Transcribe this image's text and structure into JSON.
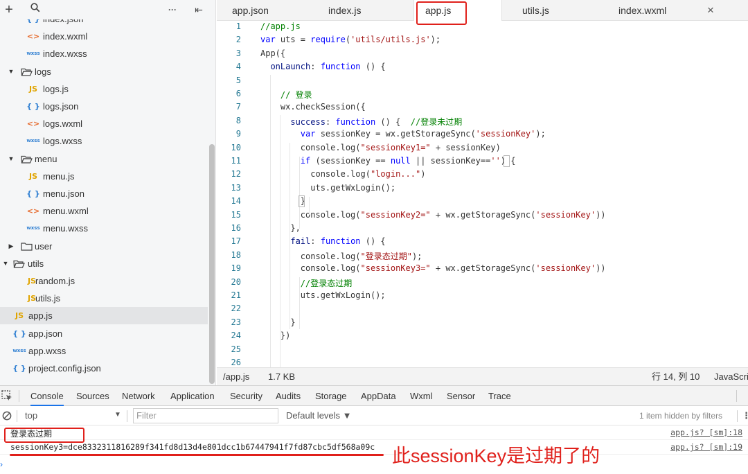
{
  "sidebar": {
    "toolbar": {
      "add": "+",
      "search": "⌕",
      "more": "···",
      "collapse": "⇤"
    },
    "rows": [
      {
        "name": "index.json",
        "icon": "json",
        "depth": 2,
        "kind": "file"
      },
      {
        "name": "index.wxml",
        "icon": "wxml",
        "depth": 2,
        "kind": "file"
      },
      {
        "name": "index.wxss",
        "icon": "wxss",
        "depth": 2,
        "kind": "file"
      },
      {
        "name": "logs",
        "icon": "folder-open",
        "depth": 1,
        "kind": "folder",
        "expanded": true
      },
      {
        "name": "logs.js",
        "icon": "js",
        "depth": 2,
        "kind": "file"
      },
      {
        "name": "logs.json",
        "icon": "json",
        "depth": 2,
        "kind": "file"
      },
      {
        "name": "logs.wxml",
        "icon": "wxml",
        "depth": 2,
        "kind": "file"
      },
      {
        "name": "logs.wxss",
        "icon": "wxss",
        "depth": 2,
        "kind": "file"
      },
      {
        "name": "menu",
        "icon": "folder-open",
        "depth": 1,
        "kind": "folder",
        "expanded": true
      },
      {
        "name": "menu.js",
        "icon": "js",
        "depth": 2,
        "kind": "file"
      },
      {
        "name": "menu.json",
        "icon": "json",
        "depth": 2,
        "kind": "file"
      },
      {
        "name": "menu.wxml",
        "icon": "wxml",
        "depth": 2,
        "kind": "file"
      },
      {
        "name": "menu.wxss",
        "icon": "wxss",
        "depth": 2,
        "kind": "file"
      },
      {
        "name": "user",
        "icon": "folder-closed",
        "depth": 1,
        "kind": "folder",
        "expanded": false
      },
      {
        "name": "utils",
        "icon": "folder-open",
        "depth": 0,
        "kind": "folder",
        "expanded": true
      },
      {
        "name": "random.js",
        "icon": "js",
        "depth": 1,
        "kind": "file"
      },
      {
        "name": "utils.js",
        "icon": "js",
        "depth": 1,
        "kind": "file"
      },
      {
        "name": "app.js",
        "icon": "js",
        "depth": 0,
        "kind": "file",
        "active": true
      },
      {
        "name": "app.json",
        "icon": "json",
        "depth": 0,
        "kind": "file"
      },
      {
        "name": "app.wxss",
        "icon": "wxss",
        "depth": 0,
        "kind": "file"
      },
      {
        "name": "project.config.json",
        "icon": "json",
        "depth": 0,
        "kind": "file"
      }
    ]
  },
  "icons": {
    "js": "JS",
    "json": "{ }",
    "wxml": "<>",
    "wxss": "wxss"
  },
  "tabs": [
    {
      "label": "app.json",
      "active": false
    },
    {
      "label": "index.js",
      "active": false
    },
    {
      "label": "app.js",
      "active": true
    },
    {
      "label": "utils.js",
      "active": false
    },
    {
      "label": "index.wxml",
      "active": false
    }
  ],
  "tab_close": "×",
  "editor": {
    "lines": [
      [
        [
          "c-cm",
          "//app.js"
        ]
      ],
      [
        [
          "c-kw",
          "var"
        ],
        [
          "",
          " uts = "
        ],
        [
          "c-kw",
          "require"
        ],
        [
          "",
          "("
        ],
        [
          "c-str",
          "'utils/utils.js'"
        ],
        [
          "",
          ");"
        ]
      ],
      [
        [
          "",
          "App({"
        ]
      ],
      [
        [
          "",
          "  "
        ],
        [
          "c-prop",
          "onLaunch"
        ],
        [
          "",
          ": "
        ],
        [
          "c-kw",
          "function"
        ],
        [
          "",
          " () {"
        ]
      ],
      [
        [
          "",
          ""
        ]
      ],
      [
        [
          "",
          "    "
        ],
        [
          "c-cm",
          "// 登录"
        ]
      ],
      [
        [
          "",
          "    wx.checkSession({"
        ]
      ],
      [
        [
          "",
          "      "
        ],
        [
          "c-prop",
          "success"
        ],
        [
          "",
          ": "
        ],
        [
          "c-kw",
          "function"
        ],
        [
          "",
          " () {  "
        ],
        [
          "c-cm",
          "//登录未过期"
        ]
      ],
      [
        [
          "",
          "        "
        ],
        [
          "c-kw",
          "var"
        ],
        [
          "",
          " sessionKey = wx.getStorageSync("
        ],
        [
          "c-str",
          "'sessionKey'"
        ],
        [
          "",
          ");"
        ]
      ],
      [
        [
          "",
          "        console.log("
        ],
        [
          "c-str",
          "\"sessionKey1=\""
        ],
        [
          "",
          " + sessionKey)"
        ]
      ],
      [
        [
          "",
          "        "
        ],
        [
          "c-kw",
          "if"
        ],
        [
          "",
          " (sessionKey == "
        ],
        [
          "c-kw",
          "null"
        ],
        [
          "",
          " || sessionKey=="
        ],
        [
          "c-str",
          "''"
        ],
        [
          "",
          ") {"
        ]
      ],
      [
        [
          "",
          "          console.log("
        ],
        [
          "c-str",
          "\"login...\""
        ],
        [
          "",
          ")"
        ]
      ],
      [
        [
          "",
          "          uts.getWxLogin();"
        ]
      ],
      [
        [
          "",
          "        }"
        ]
      ],
      [
        [
          "",
          "        console.log("
        ],
        [
          "c-str",
          "\"sessionKey2=\""
        ],
        [
          "",
          " + wx.getStorageSync("
        ],
        [
          "c-str",
          "'sessionKey'"
        ],
        [
          "",
          "))"
        ]
      ],
      [
        [
          "",
          "      },"
        ]
      ],
      [
        [
          "",
          "      "
        ],
        [
          "c-prop",
          "fail"
        ],
        [
          "",
          ": "
        ],
        [
          "c-kw",
          "function"
        ],
        [
          "",
          " () {"
        ]
      ],
      [
        [
          "",
          "        console.log("
        ],
        [
          "c-str",
          "\"登录态过期\""
        ],
        [
          "",
          ");"
        ]
      ],
      [
        [
          "",
          "        console.log("
        ],
        [
          "c-str",
          "\"sessionKey3=\""
        ],
        [
          "",
          " + wx.getStorageSync("
        ],
        [
          "c-str",
          "'sessionKey'"
        ],
        [
          "",
          "))"
        ]
      ],
      [
        [
          "",
          "        "
        ],
        [
          "c-cm",
          "//登录态过期"
        ]
      ],
      [
        [
          "",
          "        uts.getWxLogin();"
        ]
      ],
      [
        [
          "",
          ""
        ]
      ],
      [
        [
          "",
          "      }"
        ]
      ],
      [
        [
          "",
          "    })"
        ]
      ],
      [
        [
          "",
          ""
        ]
      ],
      [
        [
          "",
          ""
        ]
      ]
    ]
  },
  "statusbar": {
    "path": "/app.js",
    "size": "1.7 KB",
    "cursor": "行 14, 列 10",
    "language": "JavaScri"
  },
  "devtools": {
    "tabs": [
      "Console",
      "Sources",
      "Network",
      "Application",
      "Security",
      "Audits",
      "Storage",
      "AppData",
      "Wxml",
      "Sensor",
      "Trace"
    ],
    "active_tab": "Console",
    "context": "top",
    "filter_placeholder": "Filter",
    "levels": "Default levels ▼",
    "hidden": "1 item hidden by filters",
    "messages": [
      {
        "text": "登录态过期",
        "source": "app.js? [sm]:18"
      },
      {
        "text": "sessionKey3=dce8332311816289f341fd8d13d4e801dcc1b67447941f7fd87cbc5df568a09c",
        "source": "app.js? [sm]:19"
      }
    ],
    "annotation": "此sessionKey是过期了的",
    "prompt": "›"
  }
}
